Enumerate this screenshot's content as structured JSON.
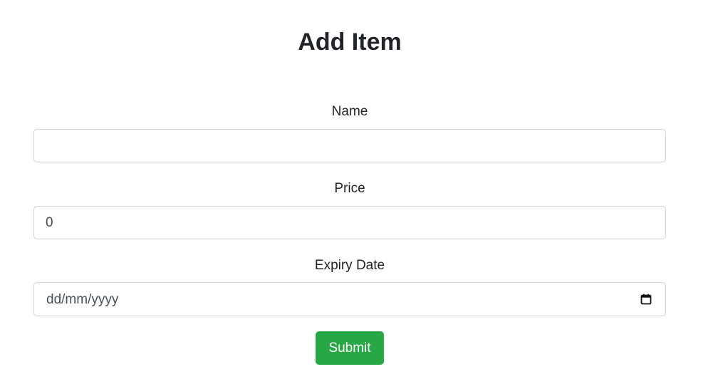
{
  "page": {
    "title": "Add Item"
  },
  "form": {
    "name": {
      "label": "Name",
      "value": ""
    },
    "price": {
      "label": "Price",
      "value": "0"
    },
    "expiry": {
      "label": "Expiry Date",
      "placeholder": "dd/mm/yyyy",
      "icon": "calendar-icon"
    },
    "submit_label": "Submit",
    "submit_color": "#28a745"
  }
}
